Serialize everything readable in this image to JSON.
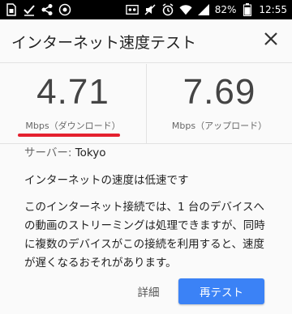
{
  "status_bar": {
    "battery": "82%",
    "time": "12:55",
    "icons": [
      "sim-icon",
      "check-icon",
      "share-icon",
      "tag-icon",
      "spacer",
      "voicemail-icon",
      "mute-icon",
      "alarm-icon",
      "wifi-icon",
      "signal-icon",
      "battery-icon"
    ]
  },
  "dialog": {
    "title": "インターネット速度テスト",
    "close_icon": "close-icon",
    "download": {
      "value": "4.71",
      "label": "Mbps（ダウンロード）",
      "highlight_color": "#e4202e"
    },
    "upload": {
      "value": "7.69",
      "label": "Mbps（アップロード）"
    },
    "server_key": "サーバー: ",
    "server_value": "Tokyo",
    "note": "インターネットの速度は低速です",
    "detail_text": "このインターネット接続では、1 台のデバイスへの動画のストリーミングは処理できますが、同時に複数のデバイスがこの接続を利用すると、速度が遅くなるおそれがあります。",
    "detail_button": "詳細",
    "retest_button": "再テスト",
    "accent_color": "#3b82f6"
  }
}
